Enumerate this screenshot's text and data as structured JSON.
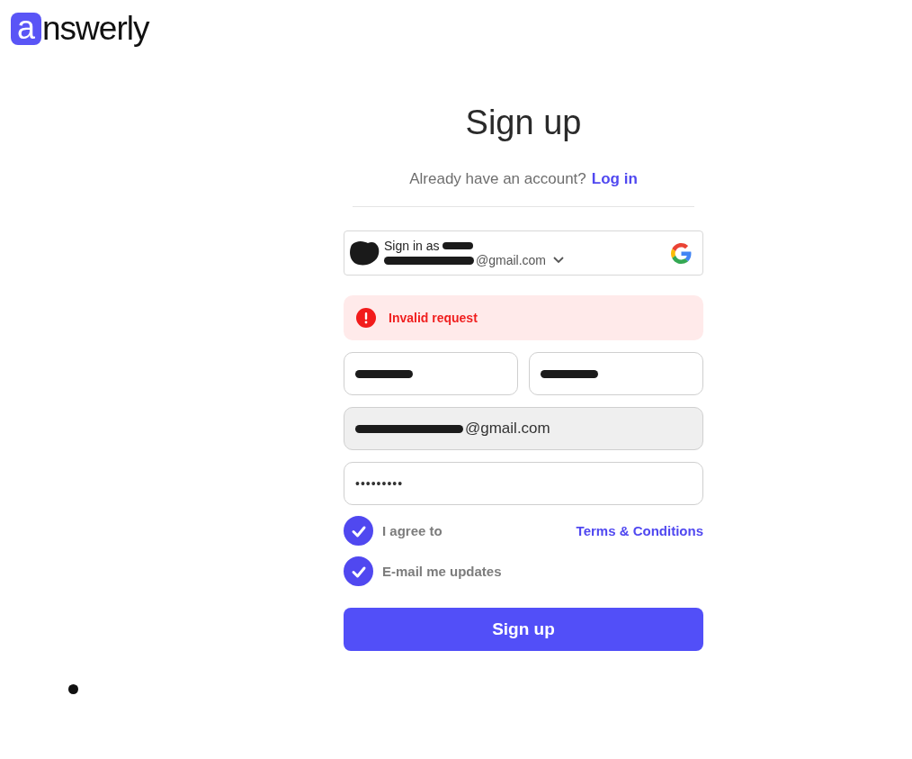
{
  "logo": {
    "badge_letter": "a",
    "rest": "nswerly"
  },
  "title": "Sign up",
  "login_prompt": {
    "text": "Already have an account?",
    "link": "Log in"
  },
  "google_account": {
    "title": "Sign in as",
    "email": "@gmail.com",
    "redacted": true
  },
  "alert": {
    "kind": "error",
    "message": "Invalid request"
  },
  "name_fields": [
    {
      "redacted": true,
      "disabled": false
    },
    {
      "redacted": true,
      "disabled": false
    }
  ],
  "fields": [
    {
      "kind": "email",
      "value": "@gmail.com",
      "redacted": true,
      "disabled": true
    },
    {
      "kind": "password",
      "value": "•••••••••",
      "redacted": false,
      "disabled": false
    }
  ],
  "checkboxes": [
    {
      "label": "I agree to",
      "checked": true,
      "link": "Terms & Conditions"
    },
    {
      "label": "E-mail me updates",
      "checked": true
    }
  ],
  "submit": "Sign up"
}
